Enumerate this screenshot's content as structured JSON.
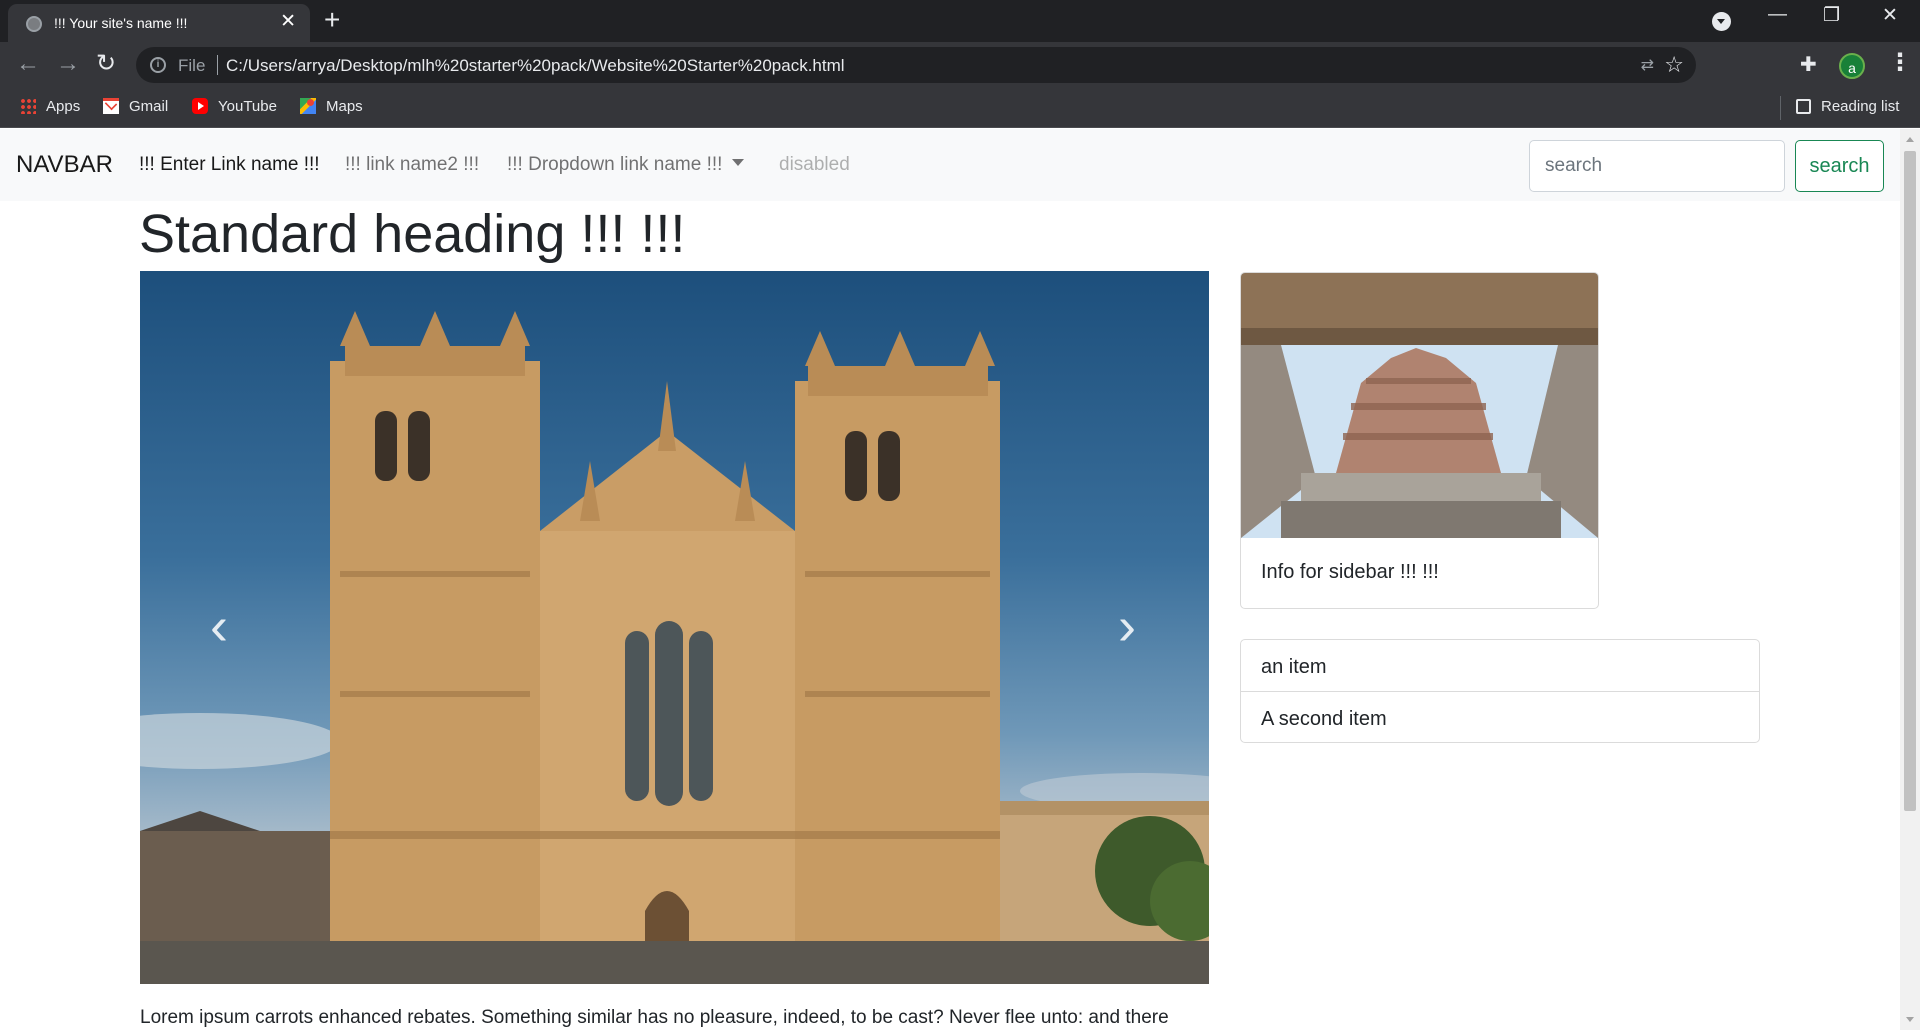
{
  "browser": {
    "tab_title": "!!! Your site's name !!!",
    "tab_close": "✕",
    "new_tab": "+",
    "address_scheme": "File",
    "address_url": "C:/Users/arrya/Desktop/mlh%20starter%20pack/Website%20Starter%20pack.html",
    "profile_initial": "a",
    "window_controls": {
      "minimize": "—",
      "restore": "❐",
      "close": "✕"
    },
    "bookmarks": [
      {
        "label": "Apps",
        "icon": "apps-grid-icon"
      },
      {
        "label": "Gmail",
        "icon": "gmail-icon"
      },
      {
        "label": "YouTube",
        "icon": "youtube-icon"
      },
      {
        "label": "Maps",
        "icon": "maps-icon"
      }
    ],
    "reading_list": "Reading list"
  },
  "navbar": {
    "brand": "NAVBAR",
    "links": [
      {
        "label": "!!! Enter Link name !!!",
        "state": "active"
      },
      {
        "label": "!!! link name2 !!!",
        "state": "normal"
      },
      {
        "label": "!!! Dropdown link name !!!",
        "state": "dropdown"
      },
      {
        "label": "disabled",
        "state": "disabled"
      }
    ],
    "search_placeholder": "search",
    "search_button": "search"
  },
  "main": {
    "heading": "Standard heading !!! !!!",
    "carousel": {
      "prev_glyph": "‹",
      "next_glyph": "›",
      "image": "cathedral-facade"
    },
    "lorem": "Lorem ipsum carrots enhanced rebates. Something similar has no pleasure, indeed, to be cast? Never flee unto: and there"
  },
  "sidebar": {
    "card_image": "temple-tower",
    "card_text": "Info for sidebar !!! !!!",
    "list_items": [
      "an item",
      "A second item"
    ]
  },
  "colors": {
    "chrome_dark": "#202124",
    "chrome_toolbar": "#35363a",
    "navbar_bg": "#f8f9fa",
    "success": "#198754"
  }
}
